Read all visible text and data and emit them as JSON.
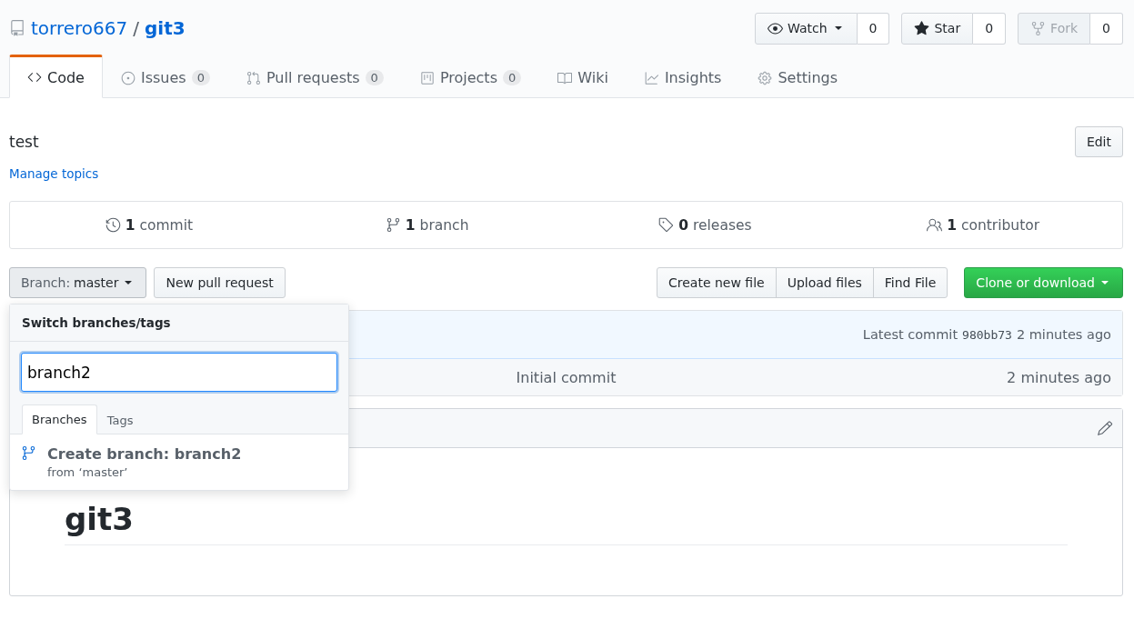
{
  "repo": {
    "owner": "torrero667",
    "separator": "/",
    "name": "git3"
  },
  "actions": [
    {
      "kind": "watch",
      "label": "Watch",
      "count": "0",
      "disabled": false
    },
    {
      "kind": "star",
      "label": "Star",
      "count": "0",
      "disabled": false
    },
    {
      "kind": "fork",
      "label": "Fork",
      "count": "0",
      "disabled": true
    }
  ],
  "tabs": [
    {
      "label": "Code",
      "selected": true
    },
    {
      "label": "Issues",
      "counter": "0",
      "selected": false
    },
    {
      "label": "Pull requests",
      "counter": "0",
      "selected": false
    },
    {
      "label": "Projects",
      "counter": "0",
      "selected": false
    },
    {
      "label": "Wiki",
      "selected": false
    },
    {
      "label": "Insights",
      "selected": false
    },
    {
      "label": "Settings",
      "selected": false
    }
  ],
  "description": "test",
  "edit_button": "Edit",
  "topics_link": "Manage topics",
  "stats": [
    {
      "number": "1",
      "label": "commit"
    },
    {
      "number": "1",
      "label": "branch"
    },
    {
      "number": "0",
      "label": "releases"
    },
    {
      "number": "1",
      "label": "contributor"
    }
  ],
  "branch_button": {
    "prefix": "Branch:",
    "value": "master"
  },
  "new_pr_button": "New pull request",
  "file_buttons": [
    "Create new file",
    "Upload files",
    "Find File"
  ],
  "clone_button": "Clone or download",
  "commit_tease": {
    "label": "Latest commit",
    "sha": "980bb73",
    "time": "2 minutes ago"
  },
  "files": [
    {
      "message": "Initial commit",
      "time": "2 minutes ago"
    }
  ],
  "readme": {
    "heading": "git3"
  },
  "branch_menu": {
    "title": "Switch branches/tags",
    "filter_value": "branch2",
    "tabs": [
      {
        "label": "Branches",
        "selected": true
      },
      {
        "label": "Tags",
        "selected": false
      }
    ],
    "create": {
      "title": "Create branch: branch2",
      "from": "from ‘master’"
    }
  }
}
